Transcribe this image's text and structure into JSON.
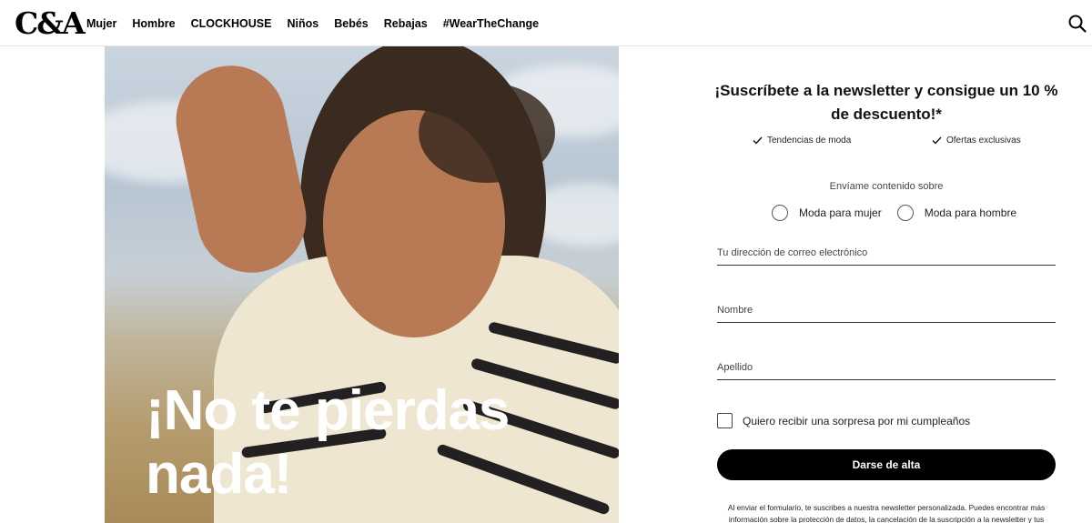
{
  "header": {
    "logo": "C&A",
    "nav": [
      "Mujer",
      "Hombre",
      "CLOCKHOUSE",
      "Niños",
      "Bebés",
      "Rebajas",
      "#WearTheChange"
    ],
    "search_icon": "search-icon"
  },
  "hero": {
    "title_line1": "¡No te pierdas",
    "title_line2": "nada!"
  },
  "newsletter": {
    "title": "¡Suscríbete a la newsletter y consigue un 10 % de descuento!*",
    "benefits": [
      "Tendencias de moda",
      "Ofertas exclusivas"
    ],
    "send_label": "Envíame contenido sobre",
    "options": [
      "Moda para mujer",
      "Moda para hombre"
    ],
    "email_placeholder": "Tu dirección de correo electrónico",
    "name_placeholder": "Nombre",
    "surname_placeholder": "Apellido",
    "birthday_label": "Quiero recibir una sorpresa por mi cumpleaños",
    "submit_label": "Darse de alta",
    "legal_text": "Al enviar el formulario, te suscribes a nuestra newsletter personalizada. Puedes encontrar más información sobre la protección de datos, la cancelación de la suscripción a la newsletter y tus"
  },
  "colors": {
    "accent": "#000000",
    "background": "#ffffff"
  }
}
